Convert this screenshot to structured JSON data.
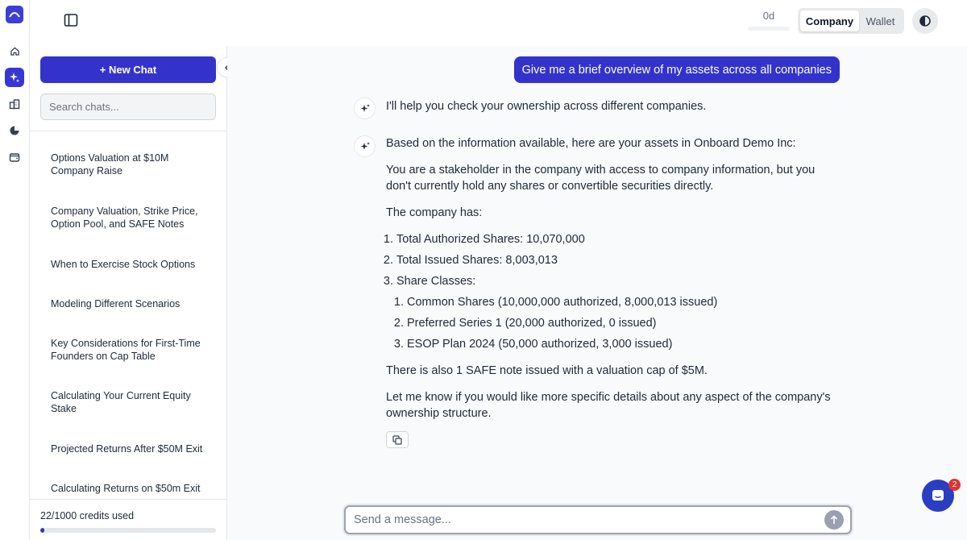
{
  "rail": {
    "items": [
      "home-icon",
      "sparkle-icon",
      "buildings-icon",
      "pie-icon",
      "wallet-icon"
    ],
    "active": "sparkle-icon"
  },
  "topbar": {
    "days_label": "0d",
    "segment": {
      "company": "Company",
      "wallet": "Wallet",
      "selected": "Company"
    }
  },
  "sidebar": {
    "new_chat_label": "+ New Chat",
    "search_placeholder": "Search chats...",
    "chats": [
      "Options Valuation at $10M Company Raise",
      "Company Valuation, Strike Price, Option Pool, and SAFE Notes",
      "When to Exercise Stock Options",
      "Modeling Different Scenarios",
      "Key Considerations for First-Time Founders on Cap Table",
      "Calculating Your Current Equity Stake",
      "Projected Returns After $50M Exit",
      "Calculating Returns on $50m Exit"
    ],
    "credits_label": "22/1000 credits used",
    "credits_fraction": 0.022
  },
  "conversation": {
    "user_message": "Give me a brief overview of my assets across all companies",
    "ai_intro": "I'll help you check your ownership across different companies.",
    "ai_heading": "Based on the information available, here are your assets in Onboard Demo Inc:",
    "ai_para1": "You are a stakeholder in the company with access to company information, but you don't currently hold any shares or convertible securities directly.",
    "ai_para2": "The company has:",
    "list": {
      "item1": "Total Authorized Shares: 10,070,000",
      "item2": "Total Issued Shares: 8,003,013",
      "item3": "Share Classes:",
      "sub1": "Common Shares (10,000,000 authorized, 8,000,013 issued)",
      "sub2": "Preferred Series 1 (20,000 authorized, 0 issued)",
      "sub3": "ESOP Plan 2024 (50,000 authorized, 3,000 issued)"
    },
    "ai_para3": "There is also 1 SAFE note issued with a valuation cap of $5M.",
    "ai_para4": "Let me know if you would like more specific details about any aspect of the company's ownership structure."
  },
  "composer": {
    "placeholder": "Send a message..."
  },
  "help": {
    "badge": "2"
  },
  "colors": {
    "accent": "#3333cc",
    "help": "#2a3ec2",
    "badge": "#e0322f"
  }
}
